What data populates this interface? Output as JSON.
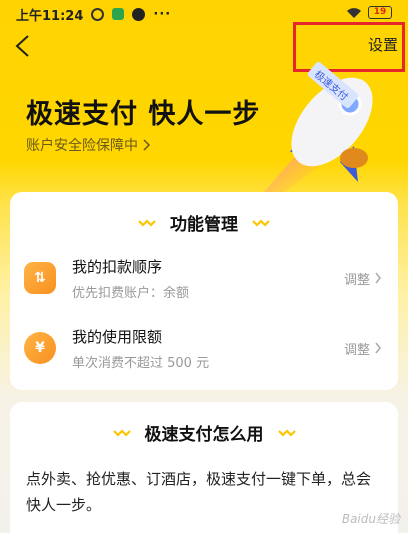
{
  "status_bar": {
    "time": "上午11:24",
    "dots": "···",
    "battery": "19"
  },
  "header": {
    "settings_label": "设置"
  },
  "hero": {
    "title": "极速支付 快人一步",
    "subtitle": "账户安全险保障中",
    "rocket_label": "极速支付"
  },
  "function_card": {
    "title": "功能管理",
    "rows": [
      {
        "title": "我的扣款顺序",
        "subtitle": "优先扣费账户：余额",
        "action": "调整",
        "icon_glyph": "⇅"
      },
      {
        "title": "我的使用限额",
        "subtitle": "单次消费不超过 500 元",
        "action": "调整",
        "icon_glyph": "¥"
      }
    ]
  },
  "howto_card": {
    "title": "极速支付怎么用",
    "description": "点外卖、抢优惠、订酒店，极速支付一键下单，总会快人一步。"
  },
  "watermark": "Baidu经验",
  "colors": {
    "brand_yellow": "#FFD300",
    "accent_orange": "#F7911E",
    "highlight_red": "#E5262B"
  }
}
